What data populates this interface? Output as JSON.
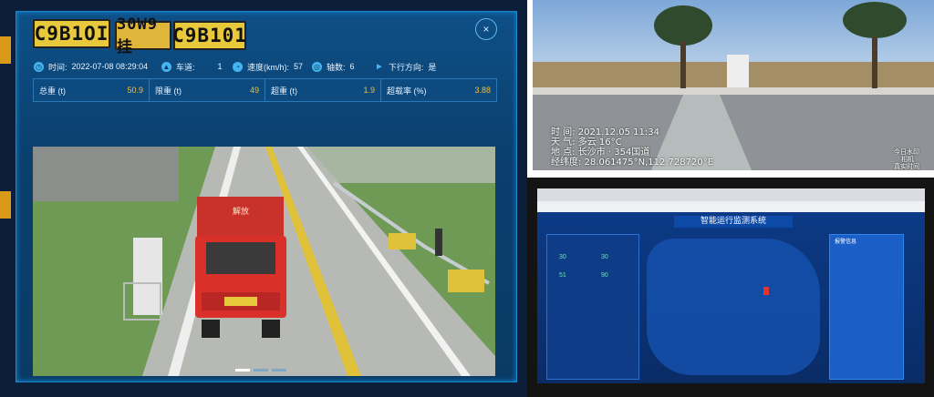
{
  "plates": [
    "C9B1OI",
    "30W9挂",
    "C9B101"
  ],
  "close_label": "×",
  "info": {
    "time_label": "时间:",
    "time": "2022-07-08 08:29:04",
    "lane_label": "车道:",
    "lane": "1",
    "speed_label": "速度(km/h):",
    "speed": "57",
    "axle_label": "轴数:",
    "axle": "6",
    "direction_label": "下行方向:",
    "direction": "是"
  },
  "stats": [
    {
      "label": "总重 (t)",
      "value": "50.9"
    },
    {
      "label": "限重 (t)",
      "value": "49"
    },
    {
      "label": "超重 (t)",
      "value": "1.9"
    },
    {
      "label": "超载率 (%)",
      "value": "3.88"
    }
  ],
  "truck_text": "解放",
  "photo": {
    "line1": "时 间: 2021.12.05 11:34",
    "line2": "天 气: 多云 16°C",
    "line3": "地 点: 长沙市 · 354国道",
    "line4": "经纬度: 28.061475°N,112.728720°E",
    "watermark1": "今日水印",
    "watermark2": "相机",
    "watermark3": "真实时间"
  },
  "monitor": {
    "system_title": "智能运行监测系统",
    "panel_title": "报警信息",
    "counts": [
      "30",
      "30",
      "51",
      "90"
    ]
  },
  "colors": {
    "panel": "#0a3f6e",
    "accent": "#f2c033",
    "plate": "#e9c93c",
    "truck": "#d9302a"
  }
}
